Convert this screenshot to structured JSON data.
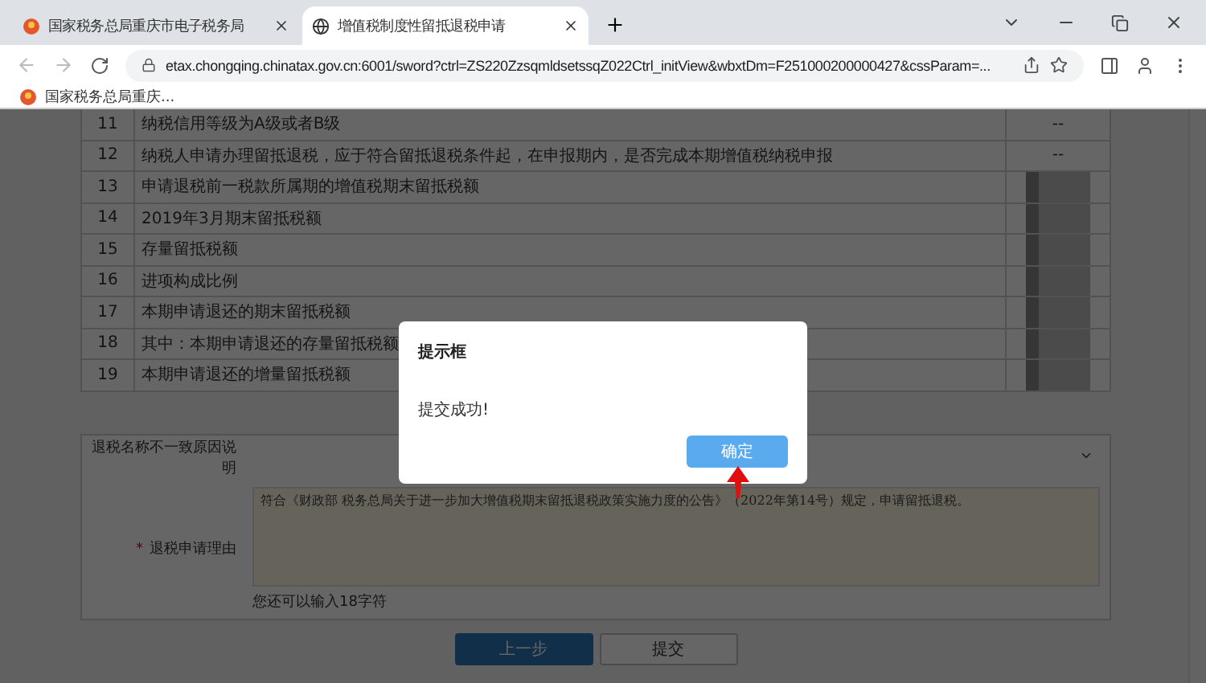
{
  "browser": {
    "tabs": [
      {
        "title": "国家税务总局重庆市电子税务局",
        "selected": false
      },
      {
        "title": "增值税制度性留抵退税申请",
        "selected": true
      }
    ],
    "url": "etax.chongqing.chinatax.gov.cn:6001/sword?ctrl=ZS220ZzsqmldsetssqZ022Ctrl_initView&wbxtDm=F251000200000427&cssParam=...",
    "bookmarks": [
      {
        "label": "国家税务总局重庆..."
      }
    ]
  },
  "table": {
    "rows": [
      {
        "number": "11",
        "label": "纳税信用等级为A级或者B级",
        "value": "--",
        "redacted": false
      },
      {
        "number": "12",
        "label": "纳税人申请办理留抵退税，应于符合留抵退税条件起，在申报期内，是否完成本期增值税纳税申报",
        "value": "--",
        "redacted": false
      },
      {
        "number": "13",
        "label": "申请退税前一税款所属期的增值税期末留抵税额",
        "redacted": true
      },
      {
        "number": "14",
        "label": "2019年3月期末留抵税额",
        "redacted": true
      },
      {
        "number": "15",
        "label": "存量留抵税额",
        "redacted": true
      },
      {
        "number": "16",
        "label": "进项构成比例",
        "redacted": true
      },
      {
        "number": "17",
        "label": "本期申请退还的期末留抵税额",
        "redacted": true
      },
      {
        "number": "18",
        "label": "其中：本期申请退还的存量留抵税额",
        "redacted": true
      },
      {
        "number": "19",
        "label": "本期申请退还的增量留抵税额",
        "redacted": true
      }
    ]
  },
  "form": {
    "mismatch_reason": {
      "label": "退税名称不一致原因说明"
    },
    "refund_reason": {
      "label": "退税申请理由",
      "required_mark": "*",
      "value": "符合《财政部 税务总局关于进一步加大增值税期末留抵退税政策实施力度的公告》（2022年第14号）规定，申请留抵退税。",
      "counter": "您还可以输入18字符"
    }
  },
  "buttons": [
    {
      "label": "上一步",
      "kind": "primary"
    },
    {
      "label": "提交",
      "kind": "default"
    }
  ],
  "dialog": {
    "title": "提示框",
    "message": "提交成功!",
    "button": "确定"
  }
}
